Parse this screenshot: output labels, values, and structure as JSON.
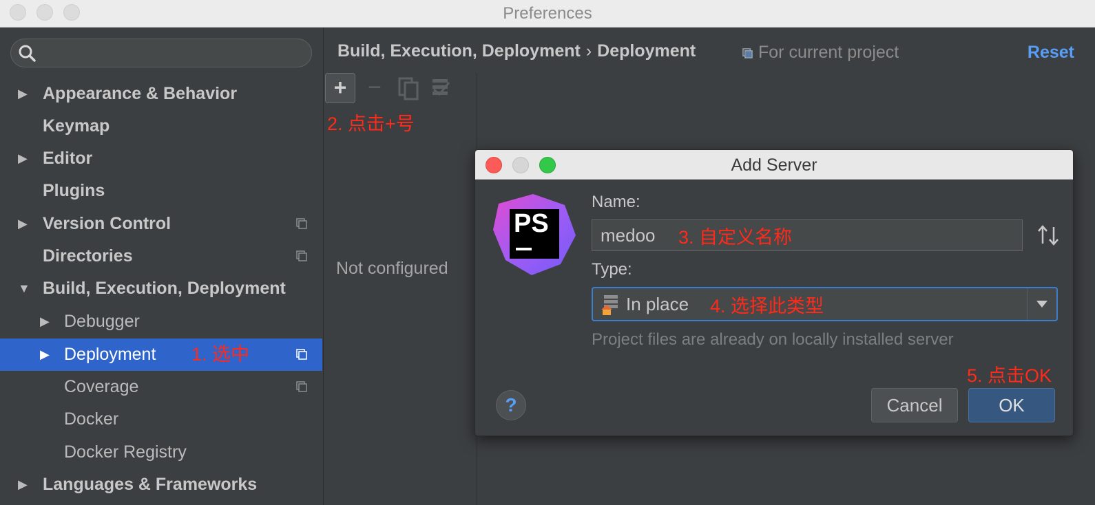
{
  "window": {
    "title": "Preferences"
  },
  "sidebar": {
    "search_placeholder": "",
    "items": [
      {
        "label": "Appearance & Behavior"
      },
      {
        "label": "Keymap"
      },
      {
        "label": "Editor"
      },
      {
        "label": "Plugins"
      },
      {
        "label": "Version Control"
      },
      {
        "label": "Directories"
      },
      {
        "label": "Build, Execution, Deployment"
      },
      {
        "label": "Debugger"
      },
      {
        "label": "Deployment"
      },
      {
        "label": "Coverage"
      },
      {
        "label": "Docker"
      },
      {
        "label": "Docker Registry"
      },
      {
        "label": "Languages & Frameworks"
      }
    ]
  },
  "main": {
    "breadcrumb": {
      "parent": "Build, Execution, Deployment",
      "separator": "›",
      "current": "Deployment"
    },
    "scope": "For current project",
    "reset": "Reset",
    "add_label": "+",
    "remove_label": "−",
    "empty_state": "Not configured"
  },
  "dialog": {
    "title": "Add Server",
    "name_label": "Name:",
    "name_value": "medoo",
    "type_label": "Type:",
    "type_value": "In place",
    "hint": "Project files are already on locally installed server",
    "help_label": "?",
    "cancel": "Cancel",
    "ok": "OK",
    "logo_text": "PS"
  },
  "annotations": {
    "a1": "1. 选中",
    "a2": "2. 点击+号",
    "a3": "3. 自定义名称",
    "a4": "4. 选择此类型",
    "a5": "5. 点击OK"
  },
  "colors": {
    "selection": "#2f65ca",
    "link": "#589df6",
    "annotation": "#ff2a1a",
    "focus": "#3d7dcc"
  }
}
